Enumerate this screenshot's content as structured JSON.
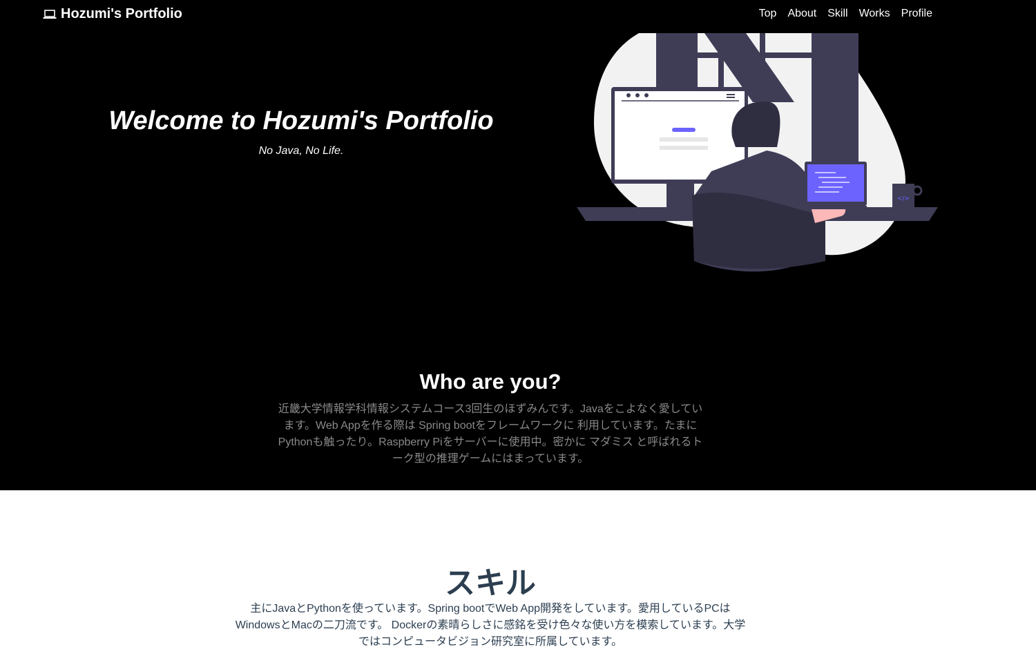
{
  "nav": {
    "brand": "Hozumi's Portfolio",
    "brand_icon": "laptop-icon",
    "links": [
      "Top",
      "About",
      "Skill",
      "Works",
      "Profile"
    ]
  },
  "hero": {
    "title": "Welcome to Hozumi's Portfolio",
    "subtitle": "No Java, No Life."
  },
  "about": {
    "title": "Who are you?",
    "text": "近畿大学情報学科情報システムコース3回生のほずみんです。Javaをこよなく愛しています。Web Appを作る際は Spring bootをフレームワークに 利用しています。たまにPythonも触ったり。Raspberry Piをサーバーに使用中。密かに マダミス と呼ばれるトーク型の推理ゲームにはまっています。"
  },
  "skill": {
    "title": "スキル",
    "text": "主にJavaとPythonを使っています。Spring bootでWeb App開発をしています。愛用しているPCはWindowsとMacの二刀流です。 Dockerの素晴らしさに感銘を受け色々な使い方を模索しています。大学ではコンピュータビジョン研究室に所属しています。"
  },
  "colors": {
    "hero_bg": "#000000",
    "accent": "#6c63ff",
    "figure": "#3f3d56",
    "heading_dark": "#2c3e50"
  }
}
